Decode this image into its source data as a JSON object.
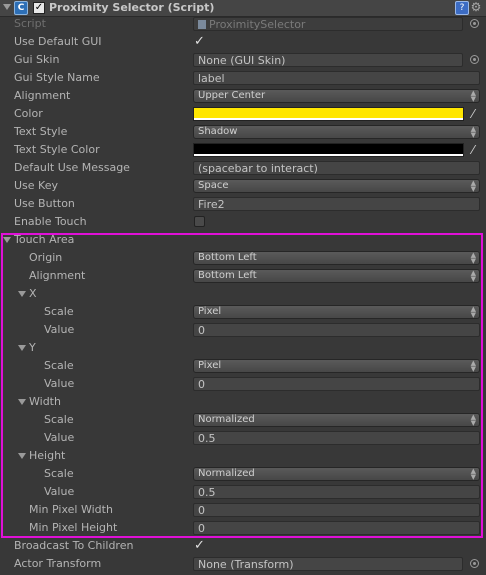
{
  "header": {
    "title": "Proximity Selector (Script)",
    "enabled": true,
    "component_icon": "script-component-icon",
    "help_icon": "help-icon",
    "settings_icon": "gear-icon"
  },
  "rows": {
    "script": {
      "label": "Script",
      "value": "ProximitySelector"
    },
    "use_default_gui": {
      "label": "Use Default GUI",
      "checked": true
    },
    "gui_skin": {
      "label": "Gui Skin",
      "value": "None (GUI Skin)"
    },
    "gui_style_name": {
      "label": "Gui Style Name",
      "value": "label"
    },
    "alignment": {
      "label": "Alignment",
      "value": "Upper Center"
    },
    "color": {
      "label": "Color",
      "color": "#ffe600"
    },
    "text_style": {
      "label": "Text Style",
      "value": "Shadow"
    },
    "text_style_color": {
      "label": "Text Style Color",
      "color": "#000000"
    },
    "default_use_message": {
      "label": "Default Use Message",
      "value": "(spacebar to interact)"
    },
    "use_key": {
      "label": "Use Key",
      "value": "Space"
    },
    "use_button": {
      "label": "Use Button",
      "value": "Fire2"
    },
    "enable_touch": {
      "label": "Enable Touch",
      "checked": false
    },
    "touch_area": {
      "label": "Touch Area",
      "origin": {
        "label": "Origin",
        "value": "Bottom Left"
      },
      "alignment": {
        "label": "Alignment",
        "value": "Bottom Left"
      },
      "x": {
        "label": "X",
        "scale_label": "Scale",
        "scale": "Pixel",
        "value_label": "Value",
        "value": "0"
      },
      "y": {
        "label": "Y",
        "scale_label": "Scale",
        "scale": "Pixel",
        "value_label": "Value",
        "value": "0"
      },
      "width": {
        "label": "Width",
        "scale_label": "Scale",
        "scale": "Normalized",
        "value_label": "Value",
        "value": "0.5"
      },
      "height": {
        "label": "Height",
        "scale_label": "Scale",
        "scale": "Normalized",
        "value_label": "Value",
        "value": "0.5"
      },
      "min_pixel_width": {
        "label": "Min Pixel Width",
        "value": "0"
      },
      "min_pixel_height": {
        "label": "Min Pixel Height",
        "value": "0"
      }
    },
    "broadcast_to_children": {
      "label": "Broadcast To Children",
      "checked": true
    },
    "actor_transform": {
      "label": "Actor Transform",
      "value": "None (Transform)"
    }
  },
  "highlight_color": "#e010d8"
}
